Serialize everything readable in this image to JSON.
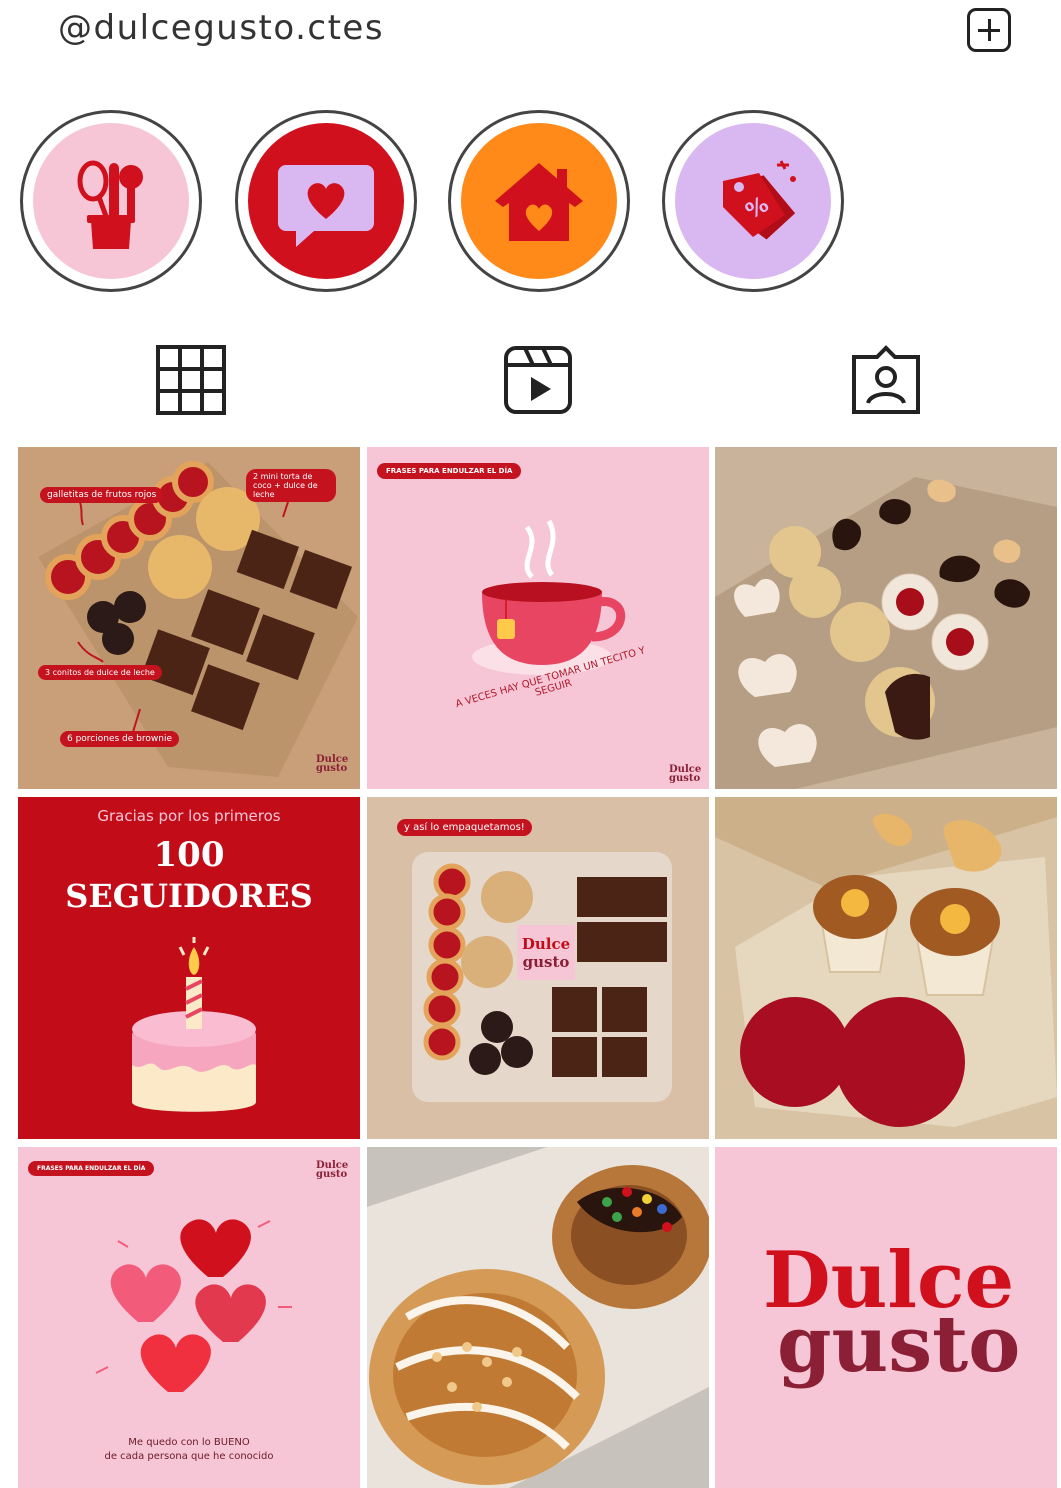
{
  "header": {
    "username": "@dulcegusto.ctes",
    "add_icon": "plus-square-icon"
  },
  "highlights": [
    {
      "icon": "kitchen-utensils-icon",
      "bg": "#f7c6d6",
      "ring": "#444444"
    },
    {
      "icon": "heart-message-icon",
      "bg": "#d0101d",
      "ring": "#444444"
    },
    {
      "icon": "heart-house-icon",
      "bg": "#ff8a1a",
      "ring": "#444444"
    },
    {
      "icon": "discount-tag-icon",
      "bg": "#d9b8f2",
      "ring": "#444444"
    }
  ],
  "tabs": [
    {
      "name": "grid",
      "icon": "grid-icon"
    },
    {
      "name": "reels",
      "icon": "reels-icon"
    },
    {
      "name": "tagged",
      "icon": "tagged-person-icon"
    }
  ],
  "posts": {
    "p1": {
      "labels": [
        "galletitas de frutos rojos",
        "2 mini torta de coco + dulce de leche",
        "3 conitos de dulce de leche",
        "6 porciones de brownie"
      ],
      "logo": "Dulce gusto"
    },
    "p2": {
      "tag": "FRASES PARA ENDULZAR EL DÍA",
      "caption": "A VECES HAY QUE TOMAR UN TECITO Y SEGUIR",
      "logo": "Dulce gusto"
    },
    "p3": {},
    "p4": {
      "line1": "Gracias por los primeros",
      "line2": "100",
      "line3": "SEGUIDORES"
    },
    "p5": {
      "label": "y así lo empaquetamos!",
      "logo": "Dulce gusto"
    },
    "p6": {},
    "p7": {
      "tag": "FRASES PARA ENDULZAR EL DÍA",
      "logo": "Dulce gusto",
      "caption1": "Me quedo con lo BUENO",
      "caption2": "de cada persona que he conocido"
    },
    "p8": {},
    "p9": {
      "logo1": "Dulce",
      "logo2": "gusto"
    }
  },
  "colors": {
    "brand_red": "#d0101d",
    "brand_pink": "#f7c6d6",
    "brand_wine": "#8a1f35"
  }
}
